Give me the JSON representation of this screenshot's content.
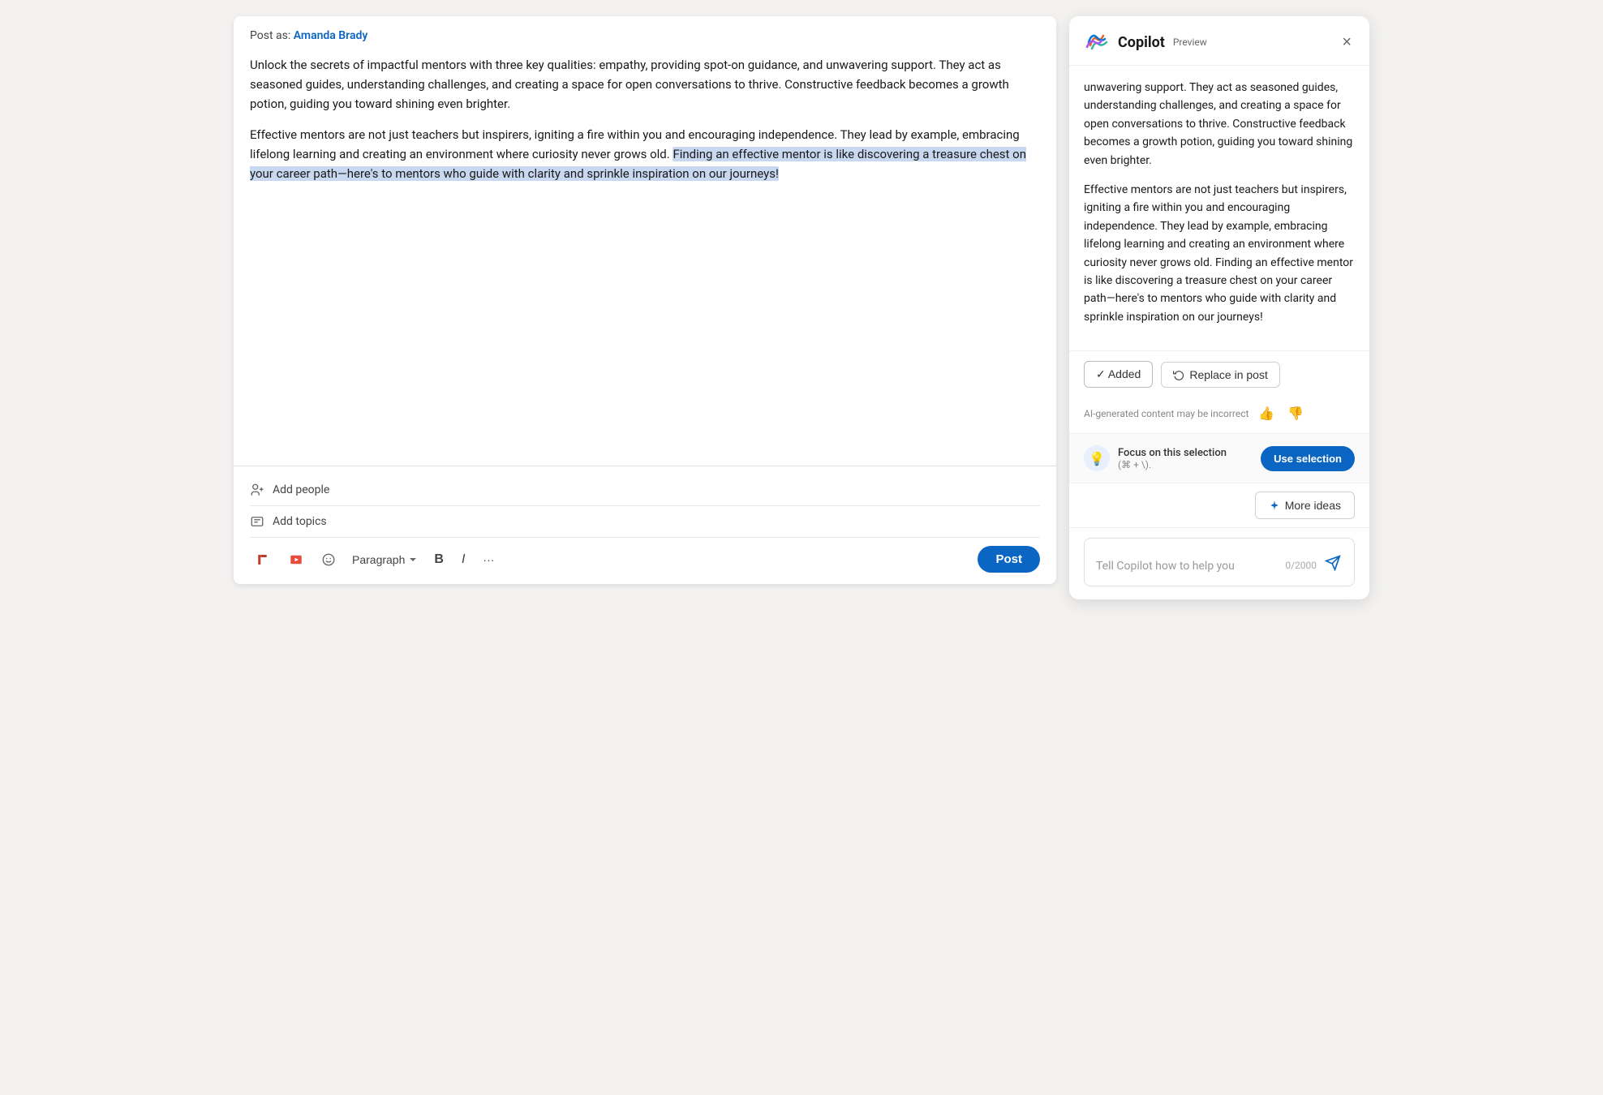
{
  "post_as": {
    "label": "Post as:",
    "author": "Amanda Brady"
  },
  "editor": {
    "paragraph1": "Unlock the secrets of impactful mentors with three key qualities: empathy, providing spot-on guidance, and unwavering support. They act as seasoned guides, understanding challenges, and creating a space for open conversations to thrive. Constructive feedback becomes a growth potion, guiding you toward shining even brighter.",
    "paragraph2_start": "Effective mentors are not just teachers but inspirers, igniting a fire within you and encouraging independence. They lead by example, embracing lifelong learning and creating an environment where curiosity never grows old. ",
    "paragraph2_highlighted": "Finding an effective mentor is like discovering a treasure chest on your career path—here's to mentors who guide with clarity and sprinkle inspiration on our journeys!",
    "add_people_label": "Add people",
    "add_topics_label": "Add topics",
    "toolbar": {
      "paragraph_label": "Paragraph",
      "bold_label": "B",
      "italic_label": "I",
      "more_label": "···",
      "post_label": "Post"
    }
  },
  "copilot": {
    "title": "Copilot",
    "preview_badge": "Preview",
    "close_label": "×",
    "body_text1": "unwavering support. They act as seasoned guides, understanding challenges, and creating a space for open conversations to thrive. Constructive feedback becomes a growth potion, guiding you toward shining even brighter.",
    "body_text2": "Effective mentors are not just teachers but inspirers, igniting a fire within you and encouraging independence. They lead by example, embracing lifelong learning and creating an environment where curiosity never grows old. Finding an effective mentor is like discovering a treasure chest on your career path—here's to mentors who guide with clarity and sprinkle inspiration on our journeys!",
    "added_btn": "✓ Added",
    "replace_btn": "Replace in post",
    "feedback_disclaimer": "AI-generated content may be incorrect",
    "focus_title": "Focus on this selection",
    "focus_shortcut": "(⌘ + \\).",
    "use_selection_btn": "Use selection",
    "more_ideas_btn": "More ideas",
    "input_placeholder": "Tell Copilot how to help you",
    "char_count": "0/2000"
  }
}
